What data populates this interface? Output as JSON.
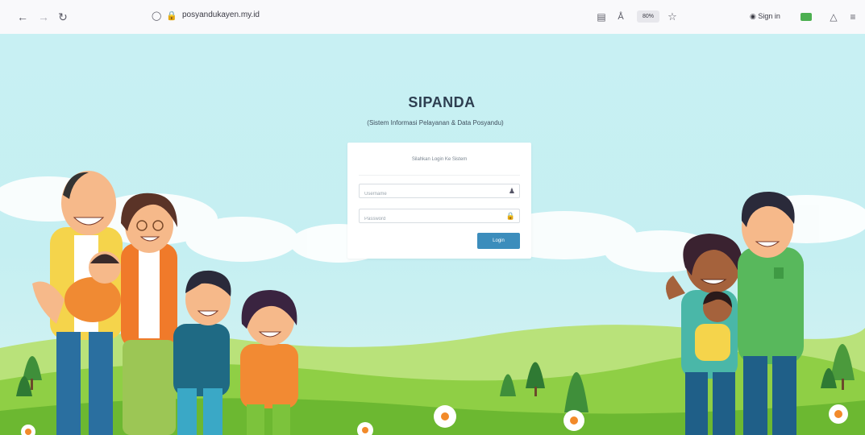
{
  "browser": {
    "nav": {
      "back_icon": "arrow-left-icon",
      "forward_icon": "arrow-right-icon",
      "reload_icon": "reload-icon"
    },
    "url": "posyandukayen.my.id",
    "zoom": "80%",
    "signin_label": "Sign in"
  },
  "app": {
    "title": "SIPANDA",
    "subtitle": "(Sistem Informasi Pelayanan & Data Posyandu)"
  },
  "login": {
    "message": "Silahkan Login Ke Sistem",
    "username_placeholder": "Username",
    "password_placeholder": "Password",
    "username_icon": "user-icon",
    "password_icon": "lock-icon",
    "button_label": "Login",
    "button_color": "#3c8dbc"
  },
  "colors": {
    "sky": "#c8f0f3",
    "grass": "#7cc33c",
    "title": "#2d3e50"
  }
}
